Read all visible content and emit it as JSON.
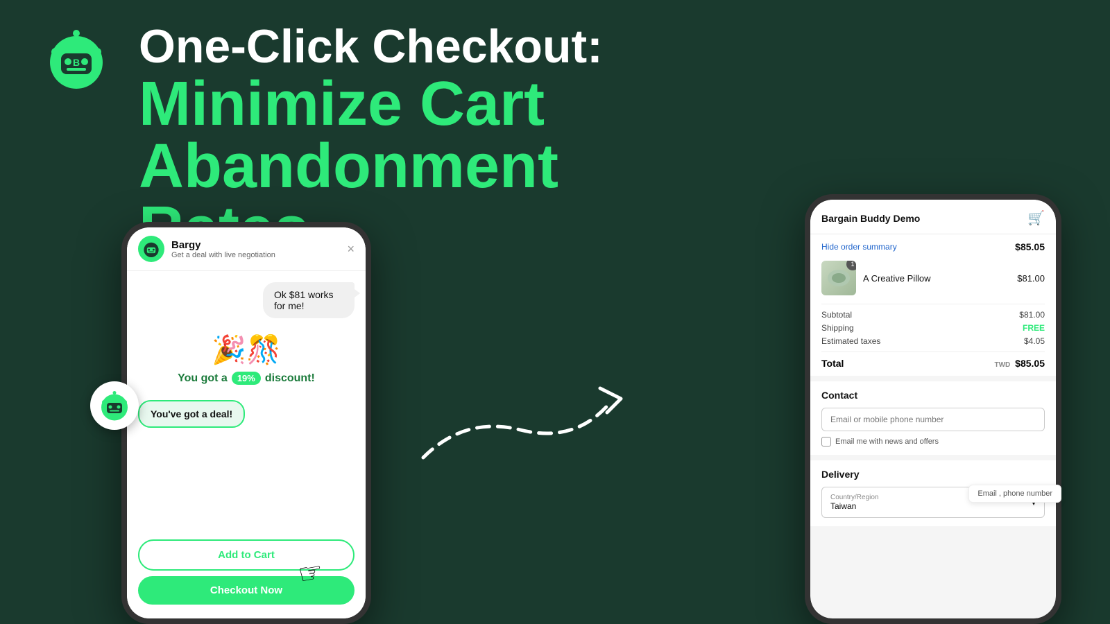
{
  "brand": {
    "name": "Bargy",
    "tagline": "Get a deal with live negotiation"
  },
  "headline": {
    "line1": "One-Click Checkout:",
    "line2": "Minimize Cart",
    "line3": "Abandonment Rates"
  },
  "colors": {
    "background": "#1a3a2e",
    "accent": "#2eea7a",
    "white": "#ffffff",
    "dark": "#111111"
  },
  "chat": {
    "message1": "Ok $81 works for me!",
    "celebration_text": "You got a",
    "discount_percent": "19%",
    "celebration_suffix": "discount!",
    "deal_message": "You've got a deal!",
    "close_label": "×",
    "add_to_cart": "Add to Cart",
    "checkout_now": "Checkout Now"
  },
  "checkout": {
    "store_name": "Bargain Buddy Demo",
    "hide_summary": "Hide order summary",
    "total_top": "$85.05",
    "product_name": "A Creative Pillow",
    "product_price": "$81.00",
    "product_qty": "1",
    "subtotal_label": "Subtotal",
    "subtotal_value": "$81.00",
    "shipping_label": "Shipping",
    "shipping_value": "FREE",
    "taxes_label": "Estimated taxes",
    "taxes_value": "$4.05",
    "total_label": "Total",
    "total_currency": "TWD",
    "total_value": "$85.05",
    "contact_section": "Contact",
    "contact_placeholder": "Email or mobile phone number",
    "contact_checkbox": "Email me with news and offers",
    "delivery_section": "Delivery",
    "country_label": "Country/Region",
    "country_value": "Taiwan"
  },
  "info_tag": {
    "text": "Email , phone number"
  }
}
